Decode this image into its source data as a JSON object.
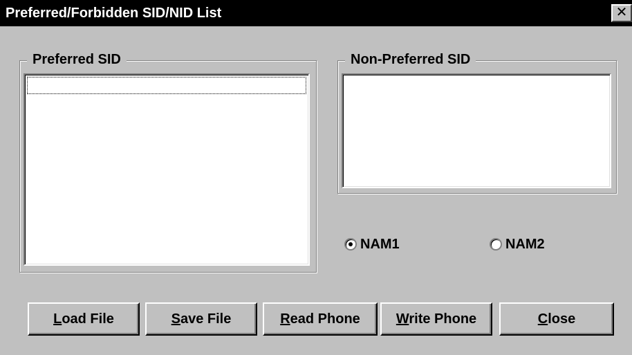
{
  "window": {
    "title": "Preferred/Forbidden SID/NID List",
    "close_glyph": "✕"
  },
  "preferred_group": {
    "label": "Preferred SID",
    "items": []
  },
  "non_preferred_group": {
    "label": "Non-Preferred SID",
    "items": []
  },
  "nam_selection": {
    "options": [
      {
        "label": "NAM1",
        "selected": true
      },
      {
        "label": "NAM2",
        "selected": false
      }
    ]
  },
  "buttons": {
    "load": {
      "accel": "L",
      "rest": "oad File"
    },
    "save": {
      "accel": "S",
      "rest": "ave File"
    },
    "read": {
      "accel": "R",
      "rest": "ead Phone"
    },
    "write": {
      "accel": "W",
      "rest": "rite Phone"
    },
    "close": {
      "accel": "C",
      "rest": "lose"
    }
  }
}
